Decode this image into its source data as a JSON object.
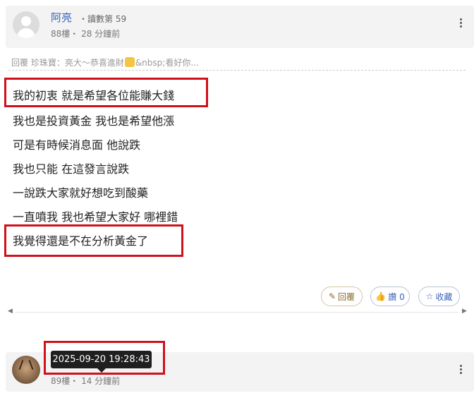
{
  "post1": {
    "username": "阿亮",
    "reads": "・讀數第 59",
    "floor": "88樓・ 28 分鐘前",
    "quote_prefix": "回覆 珍珠寶：亮大～恭喜進財",
    "quote_suffix": "&nbsp;看好你",
    "quote_ellipsis": "...",
    "lines": [
      "我的初衷 就是希望各位能賺大錢",
      "我也是投資黃金 我也是希望他漲",
      "可是有時候消息面 他說跌",
      "我也只能 在這發言說跌",
      "一說跌大家就好想吃到酸藥",
      "一直噴我 我也希望大家好 哪裡錯",
      "我覺得還是不在分析黃金了"
    ],
    "actions": {
      "reply": "回覆",
      "like": "讚 0",
      "save": "收藏"
    }
  },
  "post2": {
    "floor": "89樓・ 14 分鐘前",
    "tooltip": "2025-09-20 19:28:43"
  },
  "colors": {
    "highlight": "#d0101b",
    "link": "#3a64b8"
  }
}
